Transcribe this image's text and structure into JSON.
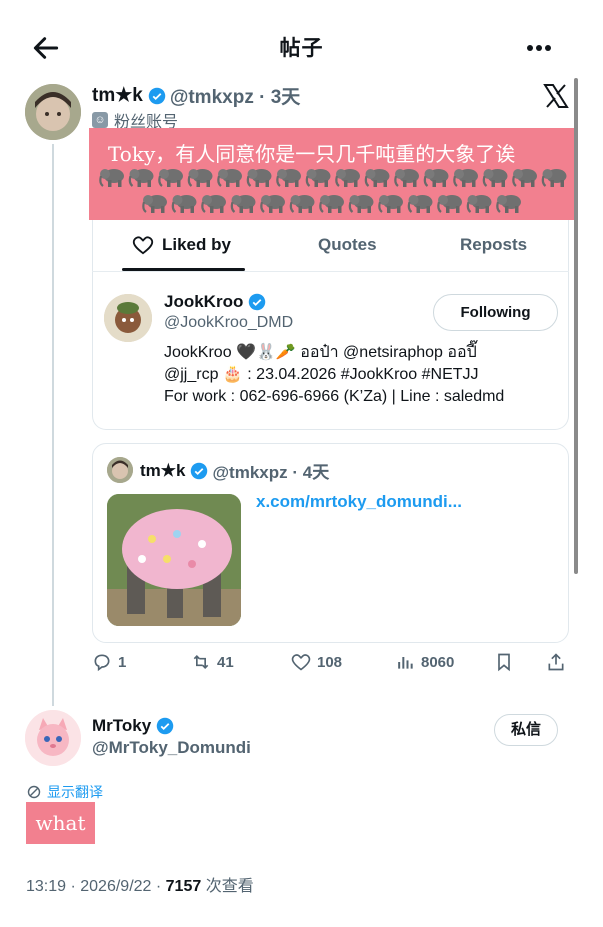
{
  "header": {
    "title": "帖子"
  },
  "post": {
    "author_name": "tm★k",
    "author_handle": "@tmkxpz · 3天",
    "fan_label": "粉丝账号",
    "banner_text": "Toky，有人同意你是一只几千吨重的大象了诶",
    "elephant_glyph": "🐘"
  },
  "tabs": {
    "liked": "Liked by",
    "quotes": "Quotes",
    "reposts": "Reposts"
  },
  "liker": {
    "name": "JookKroo",
    "handle": "@JookKroo_DMD",
    "follow_label": "Following",
    "bio_1": "JookKroo 🖤🐰🥕 ออป๋า @netsiraphop ออปี๊",
    "bio_2": "@jj_rcp 🎂 : 23.04.2026 #JookKroo #NETJJ",
    "bio_3": "For work : 062-696-6966 (K’Za) | Line : saledmd"
  },
  "quoted": {
    "author_name": "tm★k",
    "author_handle": "@tmkxpz · 4天",
    "link": "x.com/mrtoky_domundi..."
  },
  "actions": {
    "replies": "1",
    "reposts": "41",
    "likes": "108",
    "views": "8060"
  },
  "reply": {
    "name": "MrToky",
    "handle": "@MrToky_Domundi",
    "dm_label": "私信",
    "translate_label": "显示翻译",
    "text": "what",
    "time": "13:19 · 2026/9/22 · ",
    "views_count": "7157",
    "views_label": " 次查看"
  },
  "colors": {
    "accent": "#1d9bf0",
    "banner": "#f2808f",
    "muted": "#536471"
  }
}
